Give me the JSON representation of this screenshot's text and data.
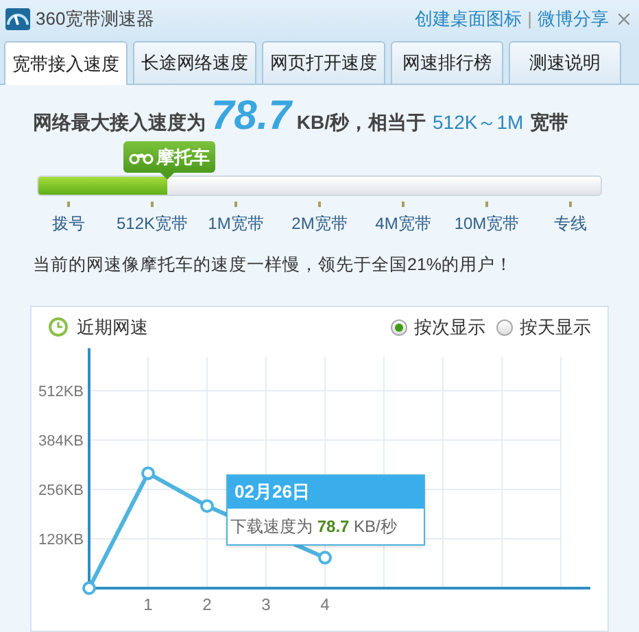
{
  "window": {
    "title": "360宽带测速器",
    "links": [
      "创建桌面图标",
      "微博分享"
    ],
    "separator": "|"
  },
  "tabs": [
    {
      "label": "宽带接入速度",
      "selected": true
    },
    {
      "label": "长途网络速度",
      "selected": false
    },
    {
      "label": "网页打开速度",
      "selected": false
    },
    {
      "label": "网速排行榜",
      "selected": false
    },
    {
      "label": "测速说明",
      "selected": false
    }
  ],
  "result": {
    "prefix": "网络最大接入速度为",
    "speed": "78.7",
    "unit": "KB/秒，相当于",
    "band": "512K～1M",
    "suffix": "宽带"
  },
  "meter": {
    "badge": "摩托车",
    "level": 0.23,
    "ticks": [
      "拨号",
      "512K宽带",
      "1M宽带",
      "2M宽带",
      "4M宽带",
      "10M宽带",
      "专线"
    ]
  },
  "summary": "当前的网速像摩托车的速度一样慢，领先于全国21%的用户！",
  "recent": {
    "title": "近期网速",
    "modes": [
      {
        "label": "按次显示",
        "selected": true
      },
      {
        "label": "按天显示",
        "selected": false
      }
    ],
    "chart_data": {
      "type": "line",
      "x": [
        0,
        1,
        2,
        3,
        4
      ],
      "grid": true,
      "series": [
        {
          "color": "#4fb3e0",
          "marker": true,
          "values": [
            0,
            298,
            213,
            null,
            79
          ]
        }
      ],
      "xlim": [
        0,
        8.5
      ],
      "ylim": [
        0,
        600
      ],
      "xticks": [
        1,
        2,
        3,
        4
      ],
      "yticks": [
        {
          "value": 128,
          "label": "128KB"
        },
        {
          "value": 256,
          "label": "256KB"
        },
        {
          "value": 384,
          "label": "384KB"
        },
        {
          "value": 512,
          "label": "512KB"
        }
      ]
    },
    "tooltip": {
      "date": "02月26日",
      "label": "下载速度为",
      "value": "78.7",
      "unit": "KB/秒"
    }
  }
}
